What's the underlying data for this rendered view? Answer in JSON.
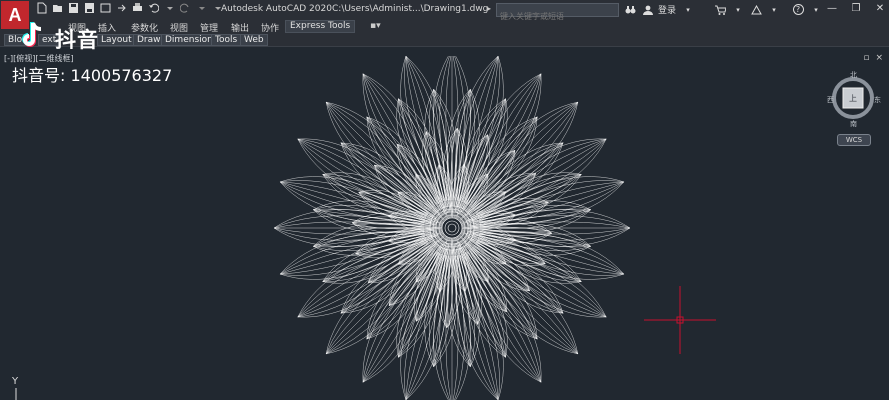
{
  "titlebar": {
    "app_logo_letter": "A",
    "app_title": "Autodesk AutoCAD 2020",
    "file_path": "C:\\Users\\Administ...\\Drawing1.dwg",
    "search_caret": "▸",
    "search_placeholder": "键入关键字或短语",
    "login_label": "登录",
    "help_icon": "?"
  },
  "menubar": {
    "items": [
      "视图",
      "插入",
      "参数化",
      "视图",
      "管理",
      "输出",
      "协作"
    ],
    "express_tools": "Express Tools",
    "extra": "▪▾"
  },
  "ribbon": {
    "tabs": [
      "Blo",
      "ext",
      "Layout",
      "Draw",
      "Dimension",
      "Tools",
      "Web"
    ]
  },
  "viewport": {
    "view_label": "[-][俯视][二维线框]",
    "close_controls": [
      "▫",
      "×"
    ]
  },
  "watermark": {
    "name": "抖音",
    "id_line": "抖音号: 1400576327"
  },
  "viewcube": {
    "north": "北",
    "south": "南",
    "west": "西",
    "east": "东",
    "top_face": "上",
    "wcs_label": "WCS"
  },
  "ucs": {
    "y_label": "Y"
  },
  "colors": {
    "background": "#212830",
    "chrome": "#2b2f36",
    "logo_red": "#c1272d",
    "crosshair": "#c8102e",
    "flower_lines": "#ffffff"
  }
}
